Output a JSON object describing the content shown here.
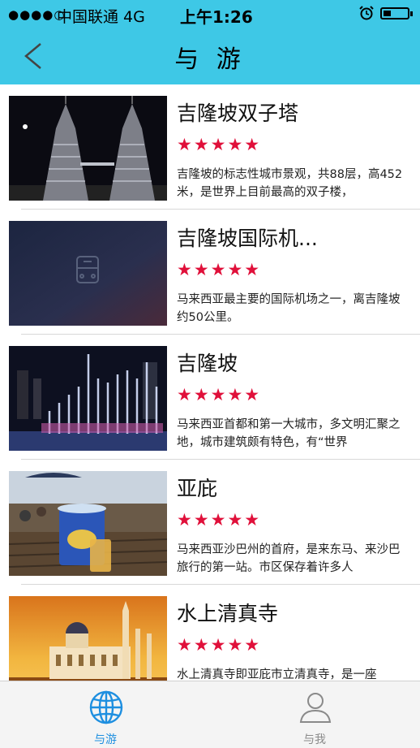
{
  "status_bar": {
    "signal": "●●●●○",
    "carrier": "中国联通  4G",
    "time": "上午1:26"
  },
  "nav": {
    "title": "与 游"
  },
  "places": [
    {
      "title": "吉隆坡双子塔",
      "rating": "★★★★★",
      "desc": "吉隆坡的标志性城市景观，共88层，高452米，是世界上目前最高的双子楼，"
    },
    {
      "title": "吉隆坡国际机...",
      "rating": "★★★★★",
      "desc": "马来西亚最主要的国际机场之一，离吉隆坡约50公里。"
    },
    {
      "title": "吉隆坡",
      "rating": "★★★★★",
      "desc": "马来西亚首都和第一大城市，多文明汇聚之地，城市建筑颇有特色，有“世界"
    },
    {
      "title": "亚庇",
      "rating": "★★★★★",
      "desc": "马来西亚沙巴州的首府，是来东马、来沙巴旅行的第一站。市区保存着许多人"
    },
    {
      "title": "水上清真寺",
      "rating": "★★★★★",
      "desc": "水上清真寺即亚庇市立清真寺，是一座"
    }
  ],
  "tabs": [
    {
      "label": "与游",
      "color": "#1e8fe0"
    },
    {
      "label": "与我",
      "color": "#8a8a8a"
    }
  ]
}
